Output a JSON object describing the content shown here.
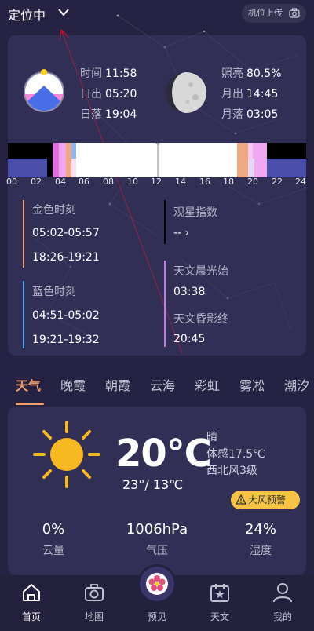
{
  "topbar": {
    "location": "定位中",
    "upload_label": "机位上传"
  },
  "sun": {
    "time_label": "时间",
    "time": "11:58",
    "rise_label": "日出",
    "rise": "05:20",
    "set_label": "日落",
    "set": "19:04"
  },
  "moon": {
    "illum_label": "照亮",
    "illum": "80.5%",
    "rise_label": "月出",
    "rise": "14:45",
    "set_label": "月落",
    "set": "03:05"
  },
  "timeline_ticks": [
    "00",
    "02",
    "04",
    "06",
    "08",
    "10",
    "12",
    "14",
    "16",
    "18",
    "20",
    "22",
    "24"
  ],
  "golden": {
    "label": "金色时刻",
    "morning": "05:02-05:57",
    "evening": "18:26-19:21"
  },
  "blue": {
    "label": "蓝色时刻",
    "morning": "04:51-05:02",
    "evening": "19:21-19:32"
  },
  "stargazing": {
    "label": "观星指数",
    "value": "-- ›"
  },
  "astro": {
    "dawn_label": "天文晨光始",
    "dawn": "03:38",
    "dusk_label": "天文昏影终",
    "dusk": "20:45"
  },
  "tabs": [
    "天气",
    "晚霞",
    "朝霞",
    "云海",
    "彩虹",
    "雾凇",
    "潮汐"
  ],
  "weather": {
    "temp": "20℃",
    "condition": "晴",
    "feels": "体感17.5℃",
    "wind": "西北风3级",
    "high_low": "23°/  13℃",
    "warning": "大风预警",
    "stats": [
      {
        "value": "0%",
        "label": "云量"
      },
      {
        "value": "1006hPa",
        "label": "气压"
      },
      {
        "value": "24%",
        "label": "湿度"
      }
    ]
  },
  "nav": [
    "首页",
    "地图",
    "预见",
    "天文",
    "我的"
  ],
  "colors": {
    "accent": "#f0a070",
    "golden": "#f0a070",
    "blue": "#4aa8f0",
    "astro": "#c47ae0",
    "warning": "#f6c344"
  }
}
